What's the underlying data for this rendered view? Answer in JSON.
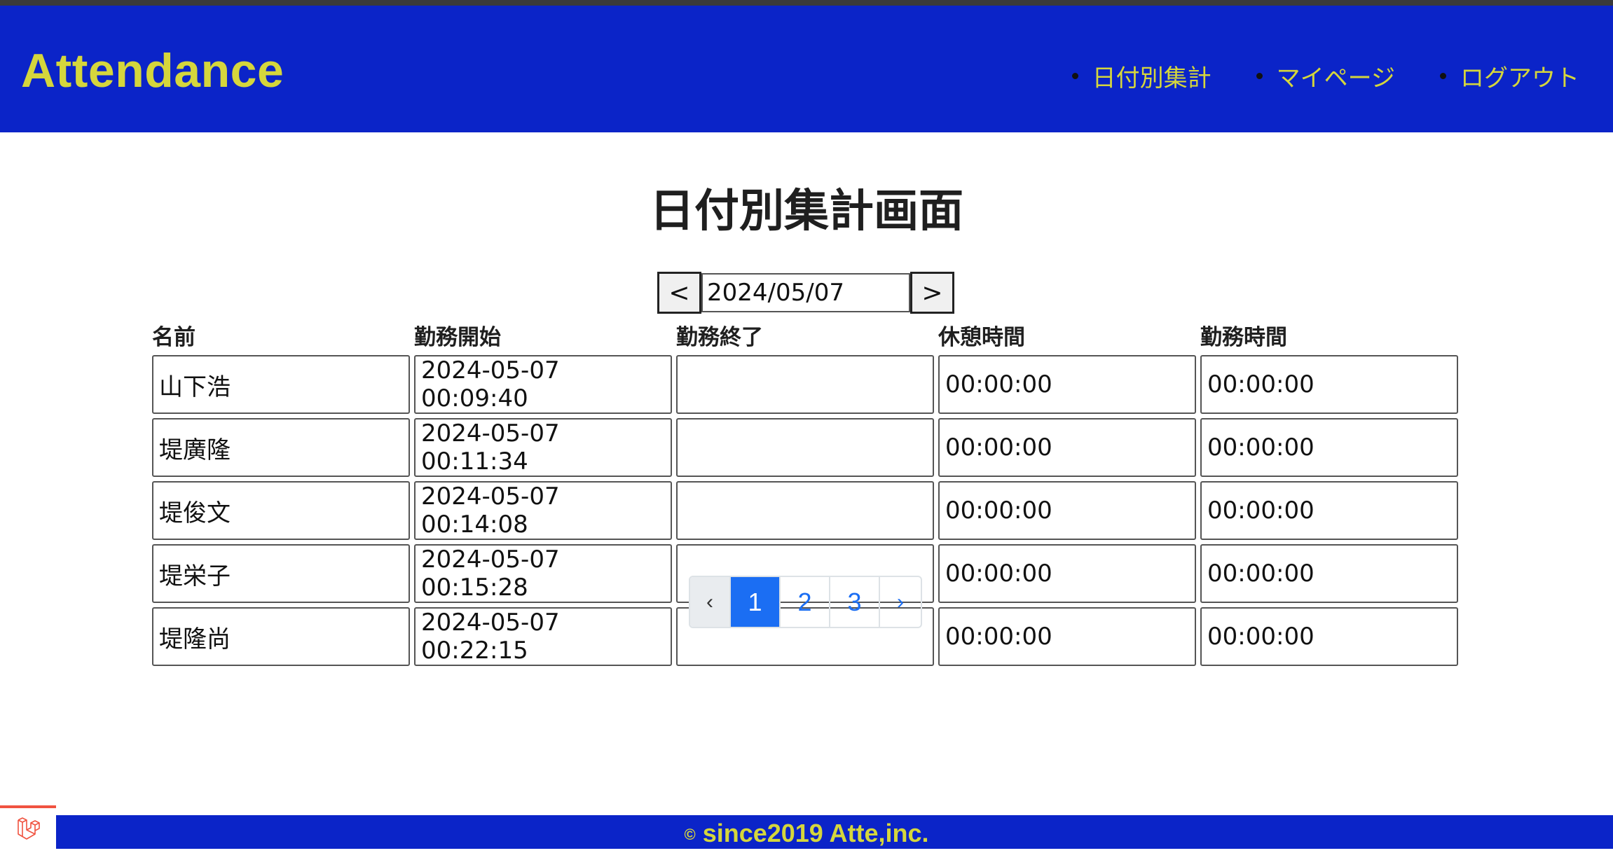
{
  "header": {
    "brand": "Attendance",
    "nav": [
      {
        "label": "日付別集計"
      },
      {
        "label": "マイページ"
      },
      {
        "label": "ログアウト"
      }
    ]
  },
  "main": {
    "title": "日付別集計画面",
    "date_nav": {
      "prev_label": "<",
      "date": "2024/05/07",
      "next_label": ">"
    },
    "table": {
      "headers": [
        "名前",
        "勤務開始",
        "勤務終了",
        "休憩時間",
        "勤務時間"
      ],
      "rows": [
        {
          "name": "山下浩",
          "start": "2024-05-07 00:09:40",
          "end": "",
          "break": "00:00:00",
          "work": "00:00:00"
        },
        {
          "name": "堤廣隆",
          "start": "2024-05-07 00:11:34",
          "end": "",
          "break": "00:00:00",
          "work": "00:00:00"
        },
        {
          "name": "堤俊文",
          "start": "2024-05-07 00:14:08",
          "end": "",
          "break": "00:00:00",
          "work": "00:00:00"
        },
        {
          "name": "堤栄子",
          "start": "2024-05-07 00:15:28",
          "end": "",
          "break": "00:00:00",
          "work": "00:00:00"
        },
        {
          "name": "堤隆尚",
          "start": "2024-05-07 00:22:15",
          "end": "",
          "break": "00:00:00",
          "work": "00:00:00"
        }
      ]
    },
    "pagination": {
      "prev": "‹",
      "pages": [
        "1",
        "2",
        "3"
      ],
      "current": "1",
      "next": "›"
    }
  },
  "footer": {
    "copyright_symbol": "©",
    "text": "since2019 Atte,inc."
  },
  "colors": {
    "header_bg": "#0b24c8",
    "brand_text": "#d5d63c",
    "pagination_active": "#1b6ef3"
  },
  "icons": {
    "corner_badge": "laravel-logo-icon"
  }
}
